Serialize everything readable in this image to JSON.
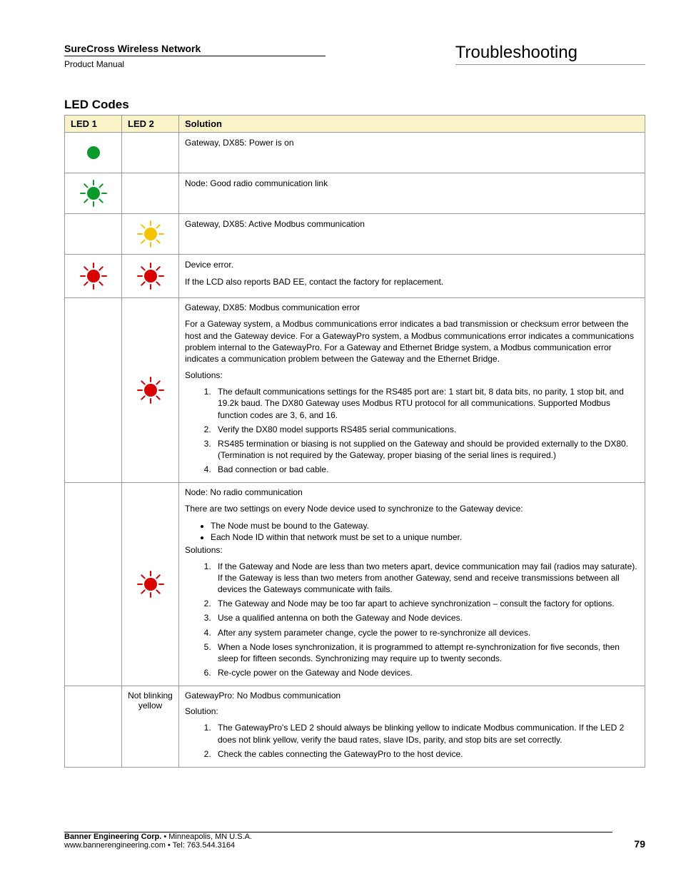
{
  "header": {
    "network_title": "SureCross Wireless Network",
    "product_manual": "Product Manual",
    "section_title": "Troubleshooting"
  },
  "section_heading": "LED Codes",
  "table": {
    "headers": {
      "led1": "LED 1",
      "led2": "LED 2",
      "solution": "Solution"
    },
    "rows": [
      {
        "led1_icon": "green-solid",
        "led2_icon": "",
        "solution_lines": [
          "Gateway, DX85: Power is on"
        ]
      },
      {
        "led1_icon": "green-flash",
        "led2_icon": "",
        "solution_lines": [
          "Node: Good radio communication link"
        ]
      },
      {
        "led1_icon": "",
        "led2_icon": "yellow-flash",
        "solution_lines": [
          "Gateway, DX85: Active Modbus communication"
        ]
      },
      {
        "led1_icon": "red-flash",
        "led2_icon": "red-flash",
        "solution_lines": [
          "Device error.",
          "If the LCD also reports BAD EE, contact the factory for replacement."
        ]
      },
      {
        "led1_icon": "",
        "led2_icon": "red-flash",
        "intro": "Gateway, DX85: Modbus communication error",
        "para": "For a Gateway system, a Modbus communications error indicates a bad transmission or checksum error between the host and the Gateway device. For a GatewayPro system, a Modbus communications error indicates a communications problem internal to the GatewayPro. For a Gateway and Ethernet Bridge system, a Modbus communication error indicates a communication problem between the Gateway and the Ethernet Bridge.",
        "solutions_label": "Solutions:",
        "ol": [
          "The default communications settings for the RS485 port are: 1 start bit, 8 data bits, no parity, 1 stop bit, and 19.2k baud. The DX80 Gateway uses Modbus RTU protocol for all communications. Supported Modbus function codes are 3, 6, and 16.",
          "Verify the DX80 model supports RS485 serial communications.",
          "RS485 termination or biasing is not supplied on the Gateway and should be provided externally to the DX80. (Termination is not required by the Gateway, proper biasing of the serial lines is required.)",
          "Bad connection or bad cable."
        ]
      },
      {
        "led1_icon": "",
        "led2_icon": "red-flash",
        "intro": "Node: No radio communication",
        "para": "There are two settings on every Node device used to synchronize to the Gateway device:",
        "bullets": [
          "The Node must be bound to the Gateway.",
          "Each Node ID within that network must be set to a unique number."
        ],
        "solutions_label": "Solutions:",
        "ol": [
          "If the Gateway and Node are less than two meters apart, device communication may fail (radios may saturate). If the Gateway is less than two meters from another Gateway, send and receive transmissions between all devices the Gateways communicate with fails.",
          "The Gateway and Node may be too far apart to achieve synchronization – consult the factory for options.",
          "Use a qualified antenna on both the Gateway and Node devices.",
          "After any system parameter change, cycle the power to re-synchronize all devices.",
          "When a Node loses synchronization, it is programmed to attempt re-synchronization for five seconds, then sleep for fifteen seconds. Synchronizing may require up to twenty seconds.",
          "Re-cycle power on the Gateway and Node devices."
        ]
      },
      {
        "led1_icon": "",
        "led2_text": "Not blinking yellow",
        "intro": "GatewayPro: No Modbus communication",
        "solutions_label": "Solution:",
        "ol": [
          "The GatewayPro's LED 2 should always be blinking yellow to indicate Modbus communication. If the LED 2 does not blink yellow, verify the baud rates, slave IDs, parity, and stop bits are set correctly.",
          "Check the cables connecting the GatewayPro to the host device."
        ]
      }
    ]
  },
  "footer": {
    "company": "Banner Engineering Corp.",
    "company_rest": " • Minneapolis, MN U.S.A.",
    "line2": "www.bannerengineering.com  •  Tel: 763.544.3164",
    "page": "79"
  }
}
